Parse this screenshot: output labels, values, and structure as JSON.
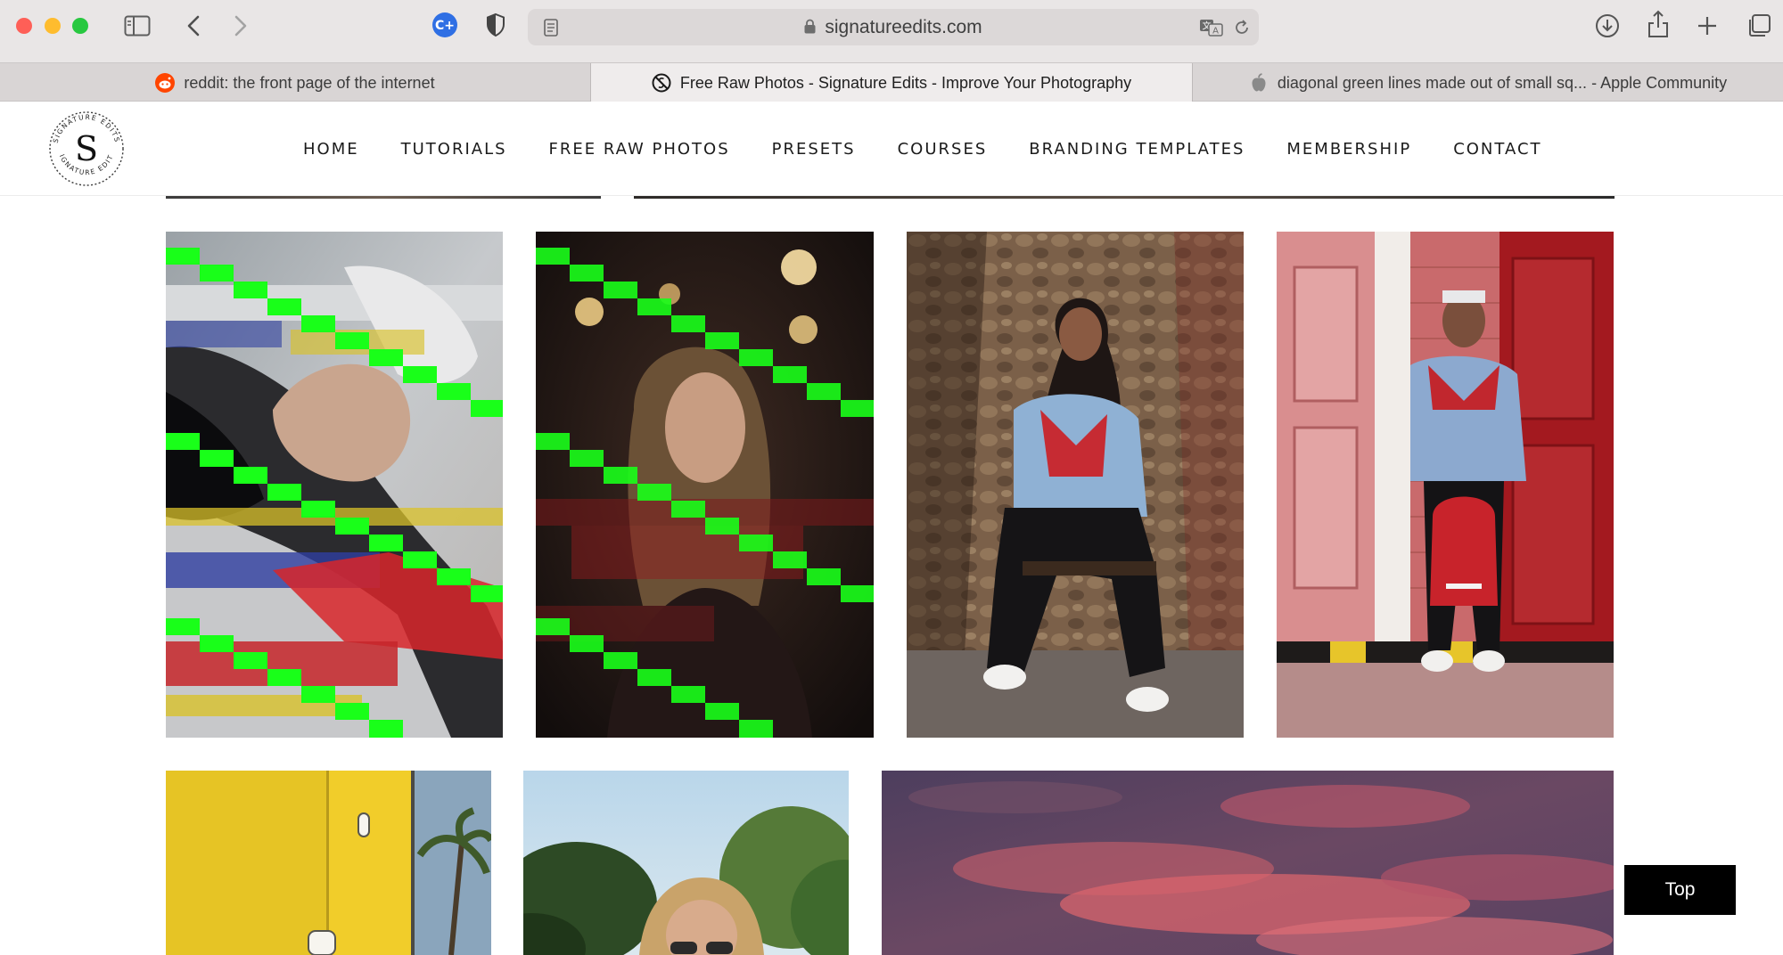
{
  "browser": {
    "url": "signatureedits.com",
    "tabs": [
      {
        "label": "reddit: the front page of the internet",
        "icon": "reddit-icon"
      },
      {
        "label": "Free Raw Photos - Signature Edits - Improve Your Photography",
        "icon": "signature-edits-icon"
      },
      {
        "label": "diagonal green lines made out of small sq... - Apple Community",
        "icon": "apple-icon"
      }
    ]
  },
  "site": {
    "logo_text": "SIGNATURE EDITS",
    "logo_letter": "S",
    "nav": {
      "home": "HOME",
      "tutorials": "TUTORIALS",
      "free_raw_photos": "FREE RAW PHOTOS",
      "presets": "PRESETS",
      "courses": "COURSES",
      "branding_templates": "BRANDING TEMPLATES",
      "membership": "MEMBERSHIP",
      "contact": "CONTACT"
    }
  },
  "gallery": {
    "top_button": "Top"
  },
  "colors": {
    "accent_green": "#19ff19",
    "nav_text": "#1b1b1b",
    "top_button_bg": "#000000"
  }
}
